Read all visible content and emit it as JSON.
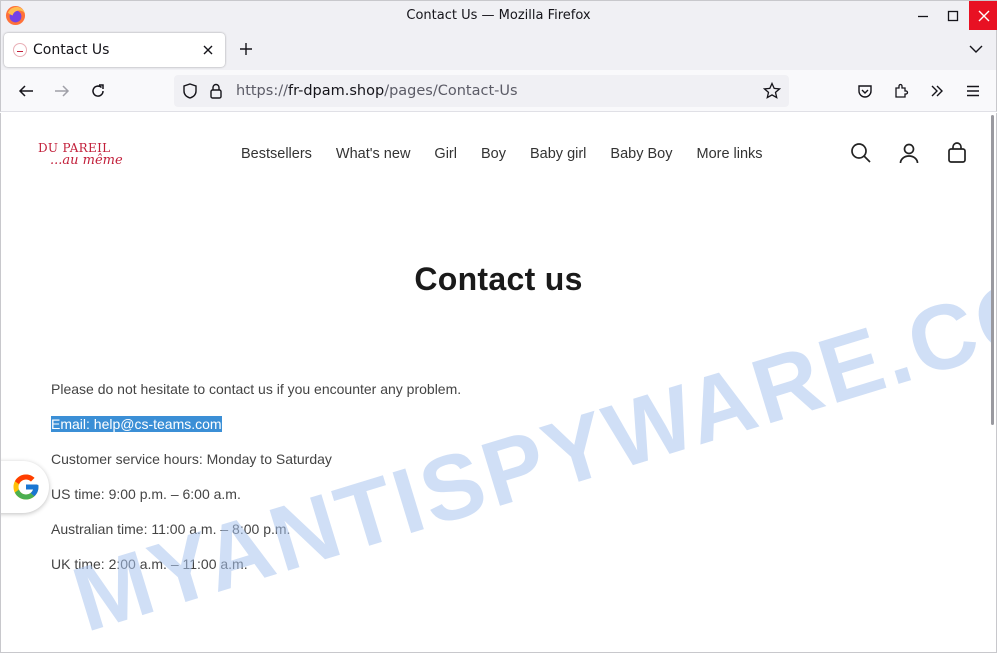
{
  "window": {
    "title": "Contact Us — Mozilla Firefox"
  },
  "tab": {
    "label": "Contact Us"
  },
  "urlbar": {
    "scheme": "https://",
    "host": "fr-dpam.shop",
    "path": "/pages/Contact-Us"
  },
  "site": {
    "logo_line1": "DU PAREIL",
    "logo_line2": "...au même",
    "menu": [
      "Bestsellers",
      "What's new",
      "Girl",
      "Boy",
      "Baby girl",
      "Baby Boy",
      "More links"
    ]
  },
  "content": {
    "heading": "Contact us",
    "intro": "Please do not hesitate to contact us if you encounter any problem.",
    "email": "Email: help@cs-teams.com",
    "hours": "Customer service hours: Monday to Saturday",
    "us_time": "US time: 9:00 p.m. – 6:00 a.m.",
    "au_time": "Australian time: 11:00 a.m. – 8:00 p.m.",
    "uk_time": "UK time: 2:00 a.m. – 11:00 a.m."
  },
  "watermark": "MYANTISPYWARE.COM",
  "colors": {
    "brand": "#c21f3a",
    "selection": "#3b8fd6",
    "close_button": "#e81123",
    "watermark": "#a9c4ee"
  }
}
